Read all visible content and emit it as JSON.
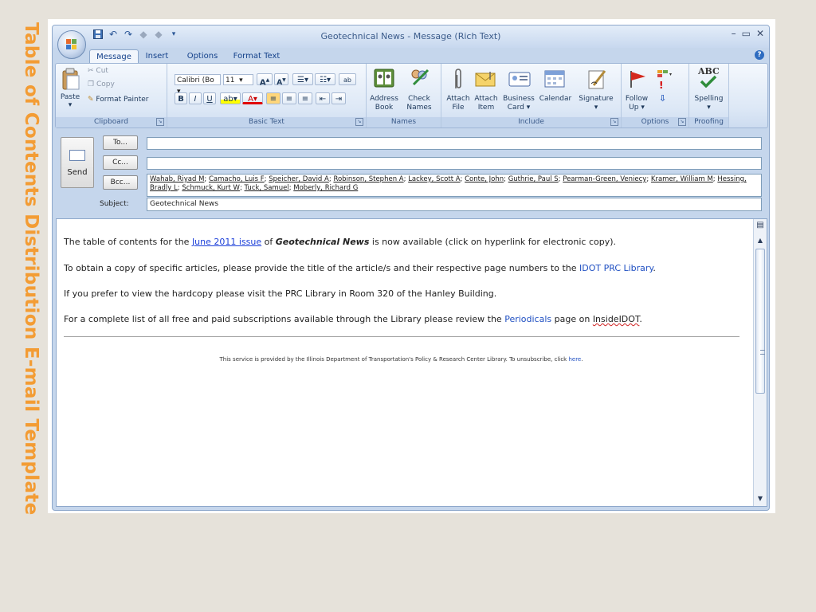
{
  "slide": {
    "side_title": "Table of Contents Distribution E-mail Template"
  },
  "window": {
    "title": "Geotechnical News - Message (Rich Text)",
    "controls": {
      "minimize": "–",
      "maximize": "▭",
      "close": "✕"
    }
  },
  "tabs": [
    {
      "label": "Message",
      "active": true
    },
    {
      "label": "Insert",
      "active": false
    },
    {
      "label": "Options",
      "active": false
    },
    {
      "label": "Format Text",
      "active": false
    }
  ],
  "ribbon": {
    "clipboard": {
      "label": "Clipboard",
      "paste": "Paste",
      "cut": "Cut",
      "copy": "Copy",
      "format_painter": "Format Painter"
    },
    "basic_text": {
      "label": "Basic Text",
      "font": "Calibri (Bo",
      "size": "11",
      "bold": "B",
      "italic": "I",
      "underline": "U",
      "grow": "A",
      "shrink": "A"
    },
    "names": {
      "label": "Names",
      "address_book": "Address Book",
      "check_names": "Check Names"
    },
    "include": {
      "label": "Include",
      "attach_file": "Attach File",
      "attach_item": "Attach Item",
      "business_card": "Business Card",
      "calendar": "Calendar",
      "signature": "Signature"
    },
    "options": {
      "label": "Options",
      "follow_up": "Follow Up"
    },
    "proofing": {
      "label": "Proofing",
      "spelling": "Spelling",
      "abc": "ABC"
    }
  },
  "addressing": {
    "send": "Send",
    "to_button": "To...",
    "cc_button": "Cc...",
    "bcc_button": "Bcc...",
    "to_value": "",
    "cc_value": "",
    "bcc_recipients": [
      "Wahab, Riyad M",
      "Camacho, Luis F",
      "Speicher, David A",
      "Robinson, Stephen A",
      "Lackey, Scott A",
      "Conte, John",
      "Guthrie, Paul S",
      "Pearman-Green, Veniecy",
      "Kramer, William M",
      "Hessing, Bradly L",
      "Schmuck, Kurt W",
      "Tuck, Samuel",
      "Moberly, Richard G"
    ],
    "subject_label": "Subject:",
    "subject_value": "Geotechnical News"
  },
  "message": {
    "p1": {
      "pre": "The table of contents for the ",
      "link": "June 2011 issue",
      "mid": " of ",
      "pub": "Geotechnical News",
      "post": " is now available (click on hyperlink for electronic copy)."
    },
    "p2": {
      "pre": "To obtain a copy of specific articles, please provide the title of the article/s and their respective page numbers to the ",
      "link": "IDOT PRC Library",
      "post": "."
    },
    "p3": "If you prefer to view the hardcopy please visit the PRC Library in Room 320 of the Hanley Building.",
    "p4": {
      "pre": "For a complete list of all free and paid subscriptions available through the Library please review the ",
      "link": "Periodicals",
      "mid": " page on ",
      "site": "InsideIDOT",
      "post": "."
    },
    "footer": {
      "pre": "This service is provided by the Illinois Department of Transportation's Policy & Research Center Library.  To unsubscribe, click ",
      "link": "here",
      "post": "."
    }
  },
  "colors": {
    "accent_orange": "#f39c34",
    "ribbon_blue": "#c5d6ec",
    "link_blue": "#1c3fd9"
  }
}
